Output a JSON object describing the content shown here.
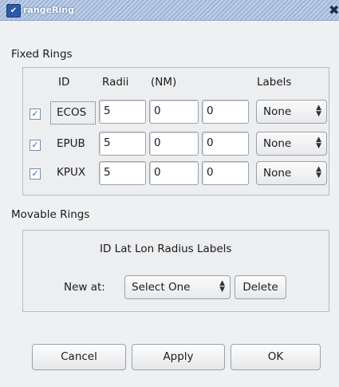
{
  "window": {
    "title": "rangeRing",
    "menu_icon": "chevron-down-icon",
    "close_icon": "close-icon"
  },
  "fixed_rings": {
    "section_label": "Fixed Rings",
    "headers": {
      "id": "ID",
      "radii": "Radii",
      "units": "(NM)",
      "labels": "Labels"
    },
    "rows": [
      {
        "checked": true,
        "id": "ECOS",
        "r1": "5",
        "r2": "0",
        "r3": "0",
        "label": "None"
      },
      {
        "checked": true,
        "id": "EPUB",
        "r1": "5",
        "r2": "0",
        "r3": "0",
        "label": "None"
      },
      {
        "checked": true,
        "id": "KPUX",
        "r1": "5",
        "r2": "0",
        "r3": "0",
        "label": "None"
      }
    ]
  },
  "movable_rings": {
    "section_label": "Movable Rings",
    "columns": "ID Lat Lon Radius Labels",
    "new_at_label": "New at:",
    "new_at_value": "Select One",
    "delete_label": "Delete"
  },
  "buttons": {
    "cancel": "Cancel",
    "apply": "Apply",
    "ok": "OK"
  }
}
